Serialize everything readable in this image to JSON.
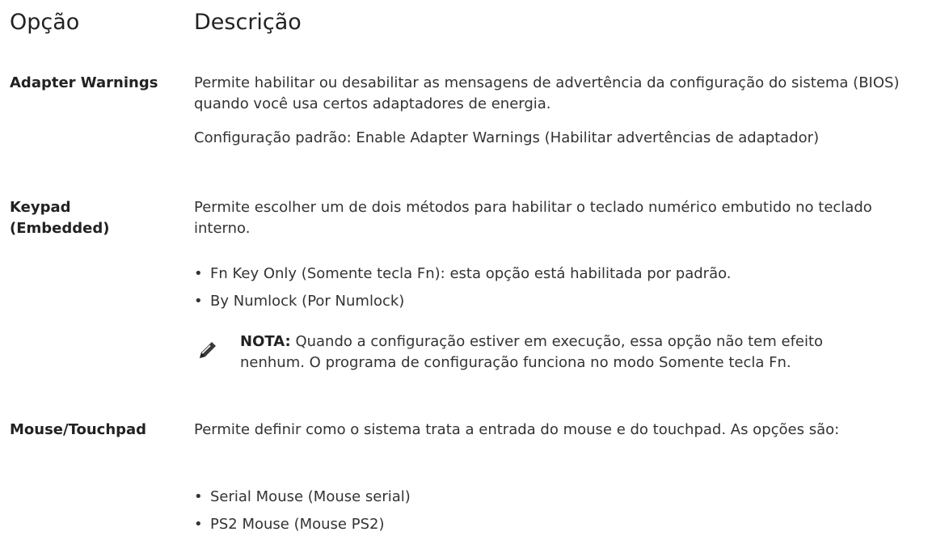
{
  "header": {
    "option": "Opção",
    "description": "Descrição"
  },
  "rows": [
    {
      "name": "Adapter Warnings",
      "paragraphs": [
        "Permite habilitar ou desabilitar as mensagens de advertência da configuração do sistema (BIOS) quando você usa certos adaptadores de energia.",
        "Configuração padrão: Enable Adapter Warnings (Habilitar advertências de adaptador)"
      ]
    },
    {
      "name": "Keypad (Embedded)",
      "paragraphs": [
        "Permite escolher um de dois métodos para habilitar o teclado numérico embutido no teclado interno."
      ],
      "bullets": [
        "Fn Key Only (Somente tecla Fn): esta opção está habilitada por padrão.",
        "By Numlock (Por Numlock)"
      ],
      "note": {
        "icon": "note-pencil-icon",
        "label": "NOTA:",
        "text": " Quando a configuração estiver em execução, essa opção não tem efeito nenhum. O programa de configuração funciona no modo Somente tecla Fn."
      }
    },
    {
      "name": "Mouse/Touchpad",
      "paragraphs": [
        "Permite definir como o sistema trata a entrada do mouse e do touchpad. As opções são:"
      ],
      "bullets": [
        "Serial Mouse (Mouse serial)",
        "PS2 Mouse (Mouse PS2)"
      ]
    }
  ]
}
